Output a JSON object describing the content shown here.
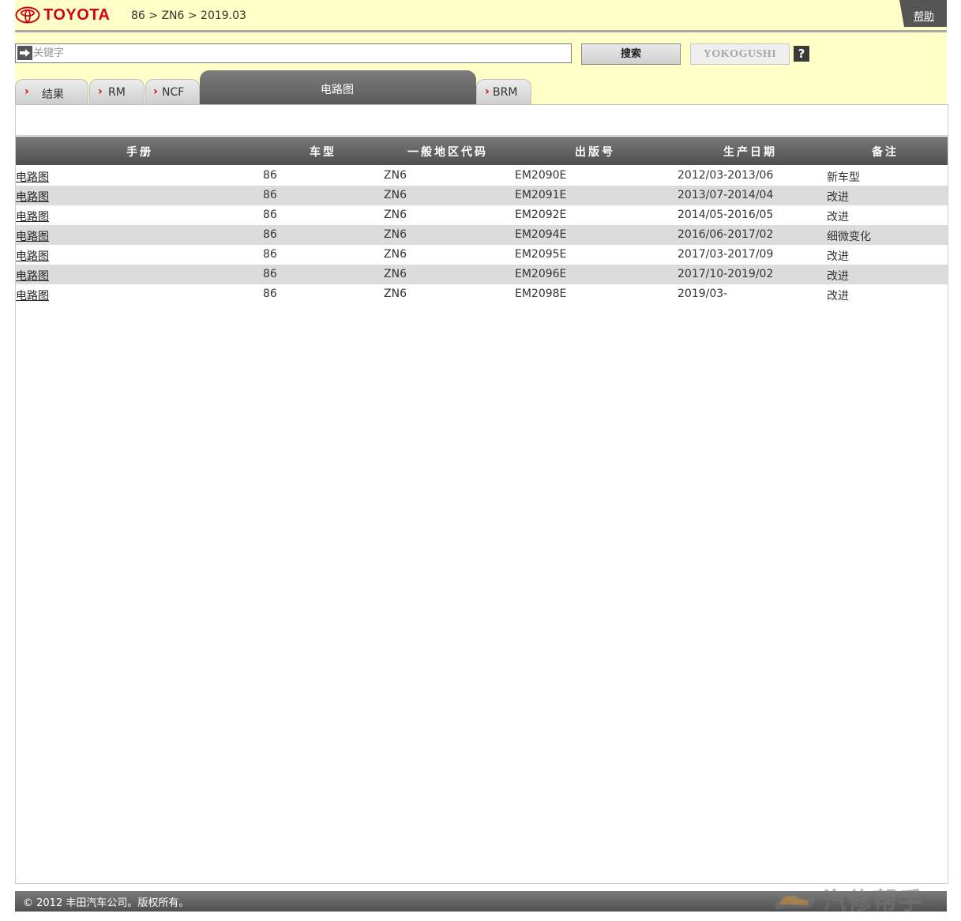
{
  "header": {
    "brand": "TOYOTA",
    "breadcrumb": "86 > ZN6 > 2019.03",
    "help_label": "帮助"
  },
  "search": {
    "placeholder": "关键字",
    "value": "",
    "search_button": "搜索",
    "yokogushi_button": "YOKOGUSHI",
    "help_button": "?"
  },
  "tabs": [
    {
      "label": "结果",
      "active": false
    },
    {
      "label": "RM",
      "active": false
    },
    {
      "label": "NCF",
      "active": false
    },
    {
      "label": "电路图",
      "active": true
    },
    {
      "label": "BRM",
      "active": false
    }
  ],
  "table": {
    "columns": [
      "手册",
      "车型",
      "一般地区代码",
      "出版号",
      "生产日期",
      "备注"
    ],
    "rows": [
      {
        "manual": "电路图",
        "model": "86",
        "region_code": "ZN6",
        "pub_no": "EM2090E",
        "date": "2012/03-2013/06",
        "note": "新车型"
      },
      {
        "manual": "电路图",
        "model": "86",
        "region_code": "ZN6",
        "pub_no": "EM2091E",
        "date": "2013/07-2014/04",
        "note": "改进"
      },
      {
        "manual": "电路图",
        "model": "86",
        "region_code": "ZN6",
        "pub_no": "EM2092E",
        "date": "2014/05-2016/05",
        "note": "改进"
      },
      {
        "manual": "电路图",
        "model": "86",
        "region_code": "ZN6",
        "pub_no": "EM2094E",
        "date": "2016/06-2017/02",
        "note": "细微变化"
      },
      {
        "manual": "电路图",
        "model": "86",
        "region_code": "ZN6",
        "pub_no": "EM2095E",
        "date": "2017/03-2017/09",
        "note": "改进"
      },
      {
        "manual": "电路图",
        "model": "86",
        "region_code": "ZN6",
        "pub_no": "EM2096E",
        "date": "2017/10-2019/02",
        "note": "改进"
      },
      {
        "manual": "电路图",
        "model": "86",
        "region_code": "ZN6",
        "pub_no": "EM2098E",
        "date": "2019/03-",
        "note": "改进"
      }
    ]
  },
  "footer": {
    "copyright": "© 2012 丰田汽车公司。版权所有。"
  },
  "watermark": {
    "text": "汽修帮手"
  },
  "colors": {
    "header_bg": "#ffffc8",
    "brand_red": "#d4001a",
    "dark_gray": "#555555",
    "row_alt": "#dcdcdc"
  }
}
